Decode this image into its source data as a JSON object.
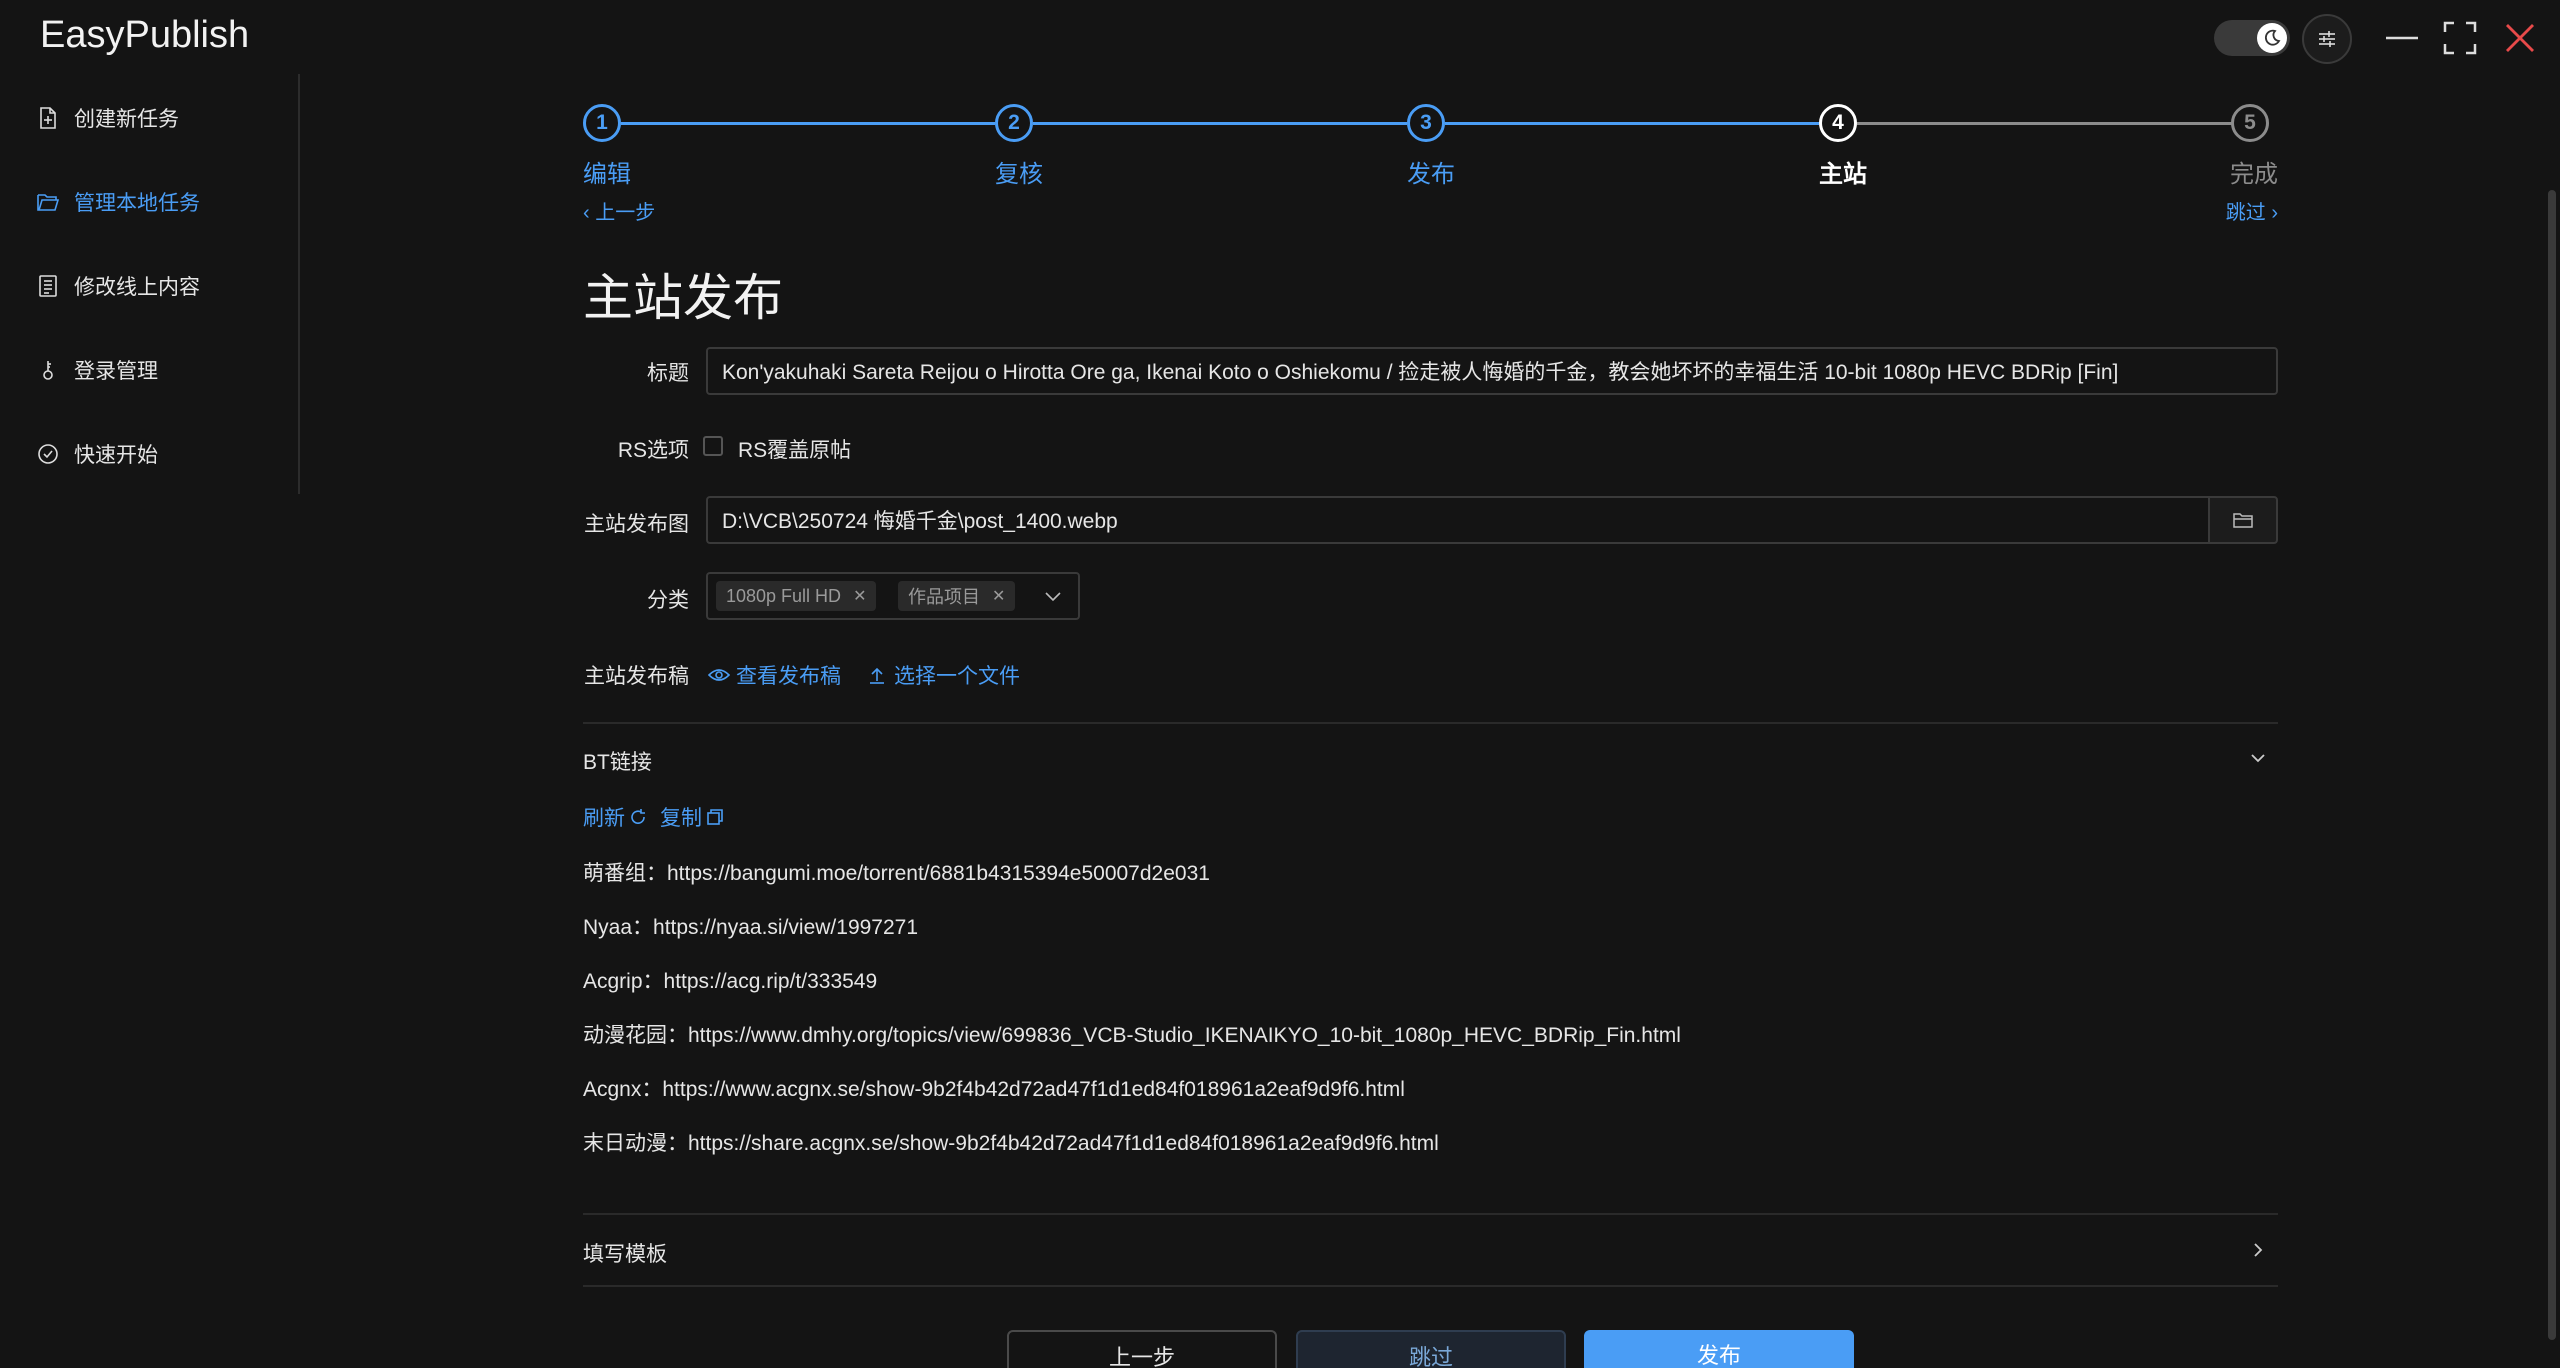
{
  "app": {
    "title": "EasyPublish"
  },
  "sidebar": {
    "items": [
      {
        "label": "创建新任务",
        "icon": "file-plus-icon"
      },
      {
        "label": "管理本地任务",
        "icon": "folder-open-icon"
      },
      {
        "label": "修改线上内容",
        "icon": "document-list-icon"
      },
      {
        "label": "登录管理",
        "icon": "key-icon"
      },
      {
        "label": "快速开始",
        "icon": "check-circle-icon"
      }
    ]
  },
  "steps": {
    "items": [
      {
        "number": "1",
        "label": "编辑",
        "state": "done"
      },
      {
        "number": "2",
        "label": "复核",
        "state": "done"
      },
      {
        "number": "3",
        "label": "发布",
        "state": "done"
      },
      {
        "number": "4",
        "label": "主站",
        "state": "current"
      },
      {
        "number": "5",
        "label": "完成",
        "state": "todo"
      }
    ],
    "prev_label": "上一步",
    "skip_label": "跳过"
  },
  "page": {
    "title": "主站发布"
  },
  "form": {
    "title_label": "标题",
    "title_value": "Kon'yakuhaki Sareta Reijou o Hirotta Ore ga, Ikenai Koto o Oshiekomu / 捡走被人悔婚的千金，教会她坏坏的幸福生活 10-bit 1080p HEVC BDRip [Fin]",
    "rs_label": "RS选项",
    "rs_checkbox_label": "RS覆盖原帖",
    "image_label": "主站发布图",
    "image_path": "D:\\VCB\\250724 悔婚千金\\post_1400.webp",
    "category_label": "分类",
    "categories": [
      "1080p Full HD",
      "作品项目"
    ],
    "draft_label": "主站发布稿",
    "view_draft": "查看发布稿",
    "choose_file": "选择一个文件"
  },
  "bt": {
    "header": "BT链接",
    "refresh": "刷新",
    "copy": "复制",
    "links": [
      "萌番组：https://bangumi.moe/torrent/6881b4315394e50007d2e031",
      "Nyaa：https://nyaa.si/view/1997271",
      "Acgrip：https://acg.rip/t/333549",
      "动漫花园：https://www.dmhy.org/topics/view/699836_VCB-Studio_IKENAIKYO_10-bit_1080p_HEVC_BDRip_Fin.html",
      "Acgnx：https://www.acgnx.se/show-9b2f4b42d72ad47f1d1ed84f018961a2eaf9d9f6.html",
      "末日动漫：https://share.acgnx.se/show-9b2f4b42d72ad47f1d1ed84f018961a2eaf9d9f6.html"
    ]
  },
  "template": {
    "header": "填写模板"
  },
  "buttons": {
    "prev": "上一步",
    "skip": "跳过",
    "publish": "发布"
  },
  "colors": {
    "accent": "#4a9df5",
    "background": "#141414",
    "close": "#e84a4a"
  }
}
